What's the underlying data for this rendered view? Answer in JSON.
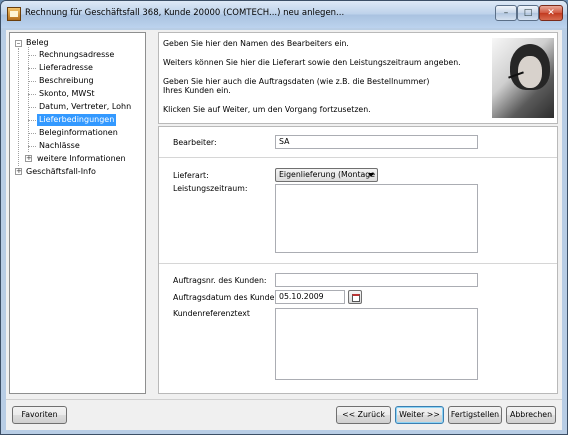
{
  "window": {
    "title": "Rechnung für Geschäftsfall 368, Kunde 20000 (COMTECH...) neu anlegen...",
    "controls": {
      "minimize": "–",
      "maximize": "□",
      "close": "✕"
    }
  },
  "tree": {
    "root": {
      "label": "Beleg",
      "expander": "–"
    },
    "children": [
      {
        "label": "Rechnungsadresse"
      },
      {
        "label": "Lieferadresse"
      },
      {
        "label": "Beschreibung"
      },
      {
        "label": "Skonto, MWSt"
      },
      {
        "label": "Datum, Vertreter, Lohn"
      },
      {
        "label": "Lieferbedingungen",
        "selected": true
      },
      {
        "label": "Beleginformationen"
      },
      {
        "label": "Nachlässe"
      },
      {
        "label": "weitere Informationen",
        "expander": "+"
      }
    ],
    "root2": {
      "label": "Geschäftsfall-Info",
      "expander": "+"
    }
  },
  "info": {
    "line1": "Geben Sie hier den Namen des Bearbeiters ein.",
    "line2": "Weiters können Sie hier die Lieferart sowie den Leistungszeitraum angeben.",
    "line3a": "Geben Sie hier auch die Auftragsdaten (wie z.B. die Bestellnummer)",
    "line3b": "Ihres Kunden ein.",
    "line4": "Klicken Sie auf Weiter, um den Vorgang fortzusetzen."
  },
  "form": {
    "bearbeiter_label": "Bearbeiter:",
    "bearbeiter_value": "SA",
    "lieferart_label": "Lieferart:",
    "lieferart_value": "Eigenlieferung (Montage",
    "leistungszeitraum_label": "Leistungszeitraum:",
    "auftragsnr_label": "Auftragsnr. des Kunden:",
    "auftragsnr_value": "",
    "auftragsdatum_label": "Auftragsdatum des Kunden:",
    "auftragsdatum_value": "05.10.2009",
    "kundenreferenz_label": "Kundenreferenztext"
  },
  "buttons": {
    "favoriten": "Favoriten",
    "zurueck": "<< Zurück",
    "weiter": "Weiter >>",
    "fertigstellen": "Fertigstellen",
    "abbrechen": "Abbrechen"
  }
}
